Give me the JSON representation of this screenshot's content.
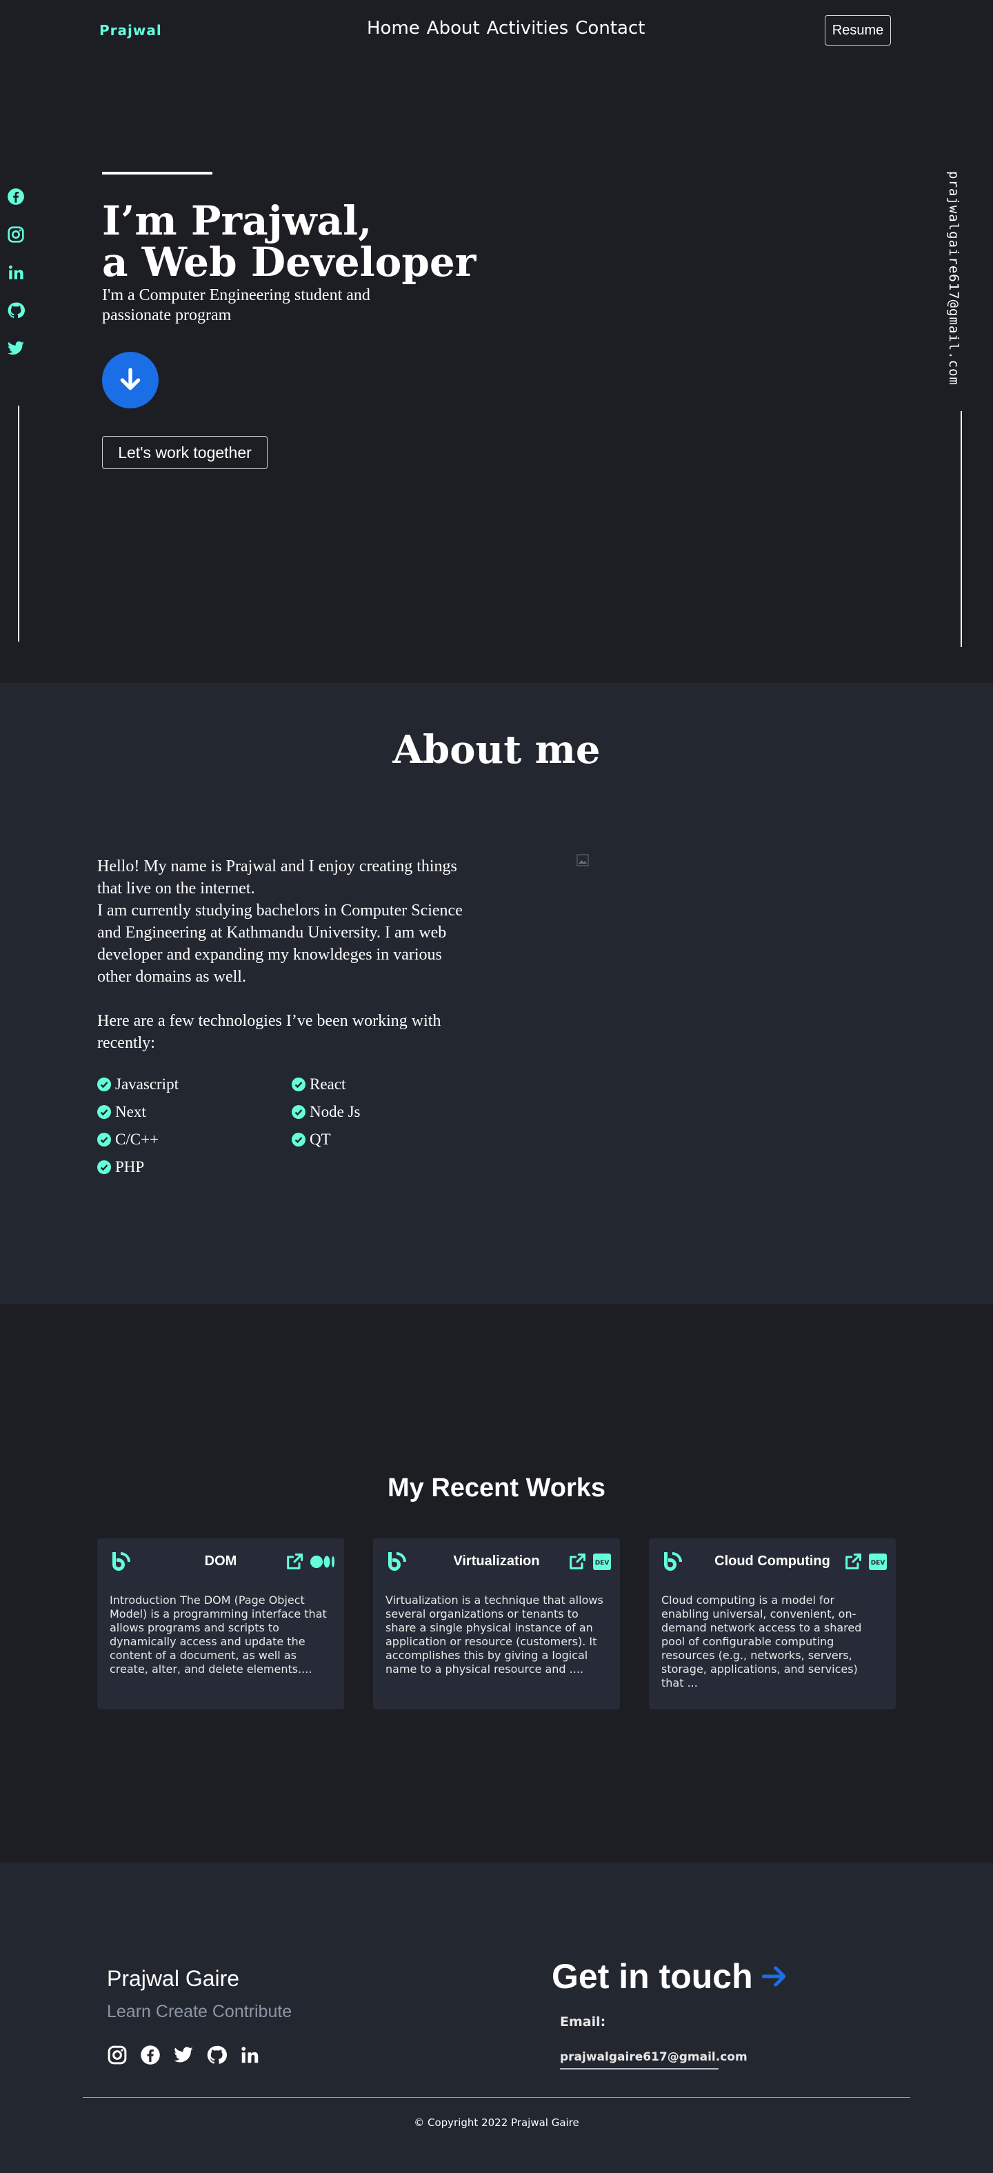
{
  "nav": {
    "logo": "Prajwal",
    "links": [
      "Home",
      "About",
      "Activities",
      "Contact"
    ],
    "resume_label": "Resume"
  },
  "social_left": [
    "facebook-icon",
    "instagram-icon",
    "linkedin-icon",
    "github-icon",
    "twitter-icon"
  ],
  "email_vertical": "prajwalgaire617@gmail.com",
  "hero": {
    "title_line1": "I’m Prajwal,",
    "title_line2": "a Web Developer",
    "subtitle": "I'm a Computer Engineering student and passionate program",
    "cta_label": "Let's work together"
  },
  "about": {
    "title": "About me",
    "para1": "Hello! My name is Prajwal and I enjoy creating things that live on the internet.",
    "para2": "I am currently studying bachelors in Computer Science and Engineering at Kathmandu University. I am web developer and expanding my knowldeges in various other domains as well.",
    "para3": "Here are a few technologies I’ve been working with recently:",
    "technologies": [
      "Javascript",
      "React",
      "Next",
      "Node Js",
      "C/C++",
      "QT",
      "PHP"
    ]
  },
  "works": {
    "title": "My Recent Works",
    "cards": [
      {
        "title": "DOM",
        "body": "Introduction The DOM (Page Object Model) is a programming interface that allows programs and scripts to dynamically access and update the content of a document, as well as create, alter, and delete elements....",
        "platform": "medium"
      },
      {
        "title": "Virtualization",
        "body": "Virtualization is a technique that allows several organizations or tenants to share a single physical instance of an application or resource (customers). It accomplishes this by giving a logical name to a physical resource and ....",
        "platform": "dev"
      },
      {
        "title": "Cloud Computing",
        "body": "Cloud computing is a model for enabling universal, convenient, on-demand network access to a shared pool of configurable computing resources (e.g., networks, servers, storage, applications, and services) that ...",
        "platform": "dev"
      }
    ]
  },
  "footer": {
    "name": "Prajwal Gaire",
    "tagline": "Learn Create Contribute",
    "socials": [
      "instagram-icon",
      "facebook-icon",
      "twitter-icon",
      "github-icon",
      "linkedin-icon"
    ],
    "get_in_touch": "Get in touch",
    "email_label": "Email:",
    "email": "prajwalgaire617@gmail.com",
    "copyright": "© Copyright 2022 Prajwal Gaire"
  },
  "colors": {
    "accent": "#64ffda",
    "blue": "#1a6ee6",
    "bg": "#1c1e23",
    "section": "#23272f",
    "card": "#262b37"
  }
}
